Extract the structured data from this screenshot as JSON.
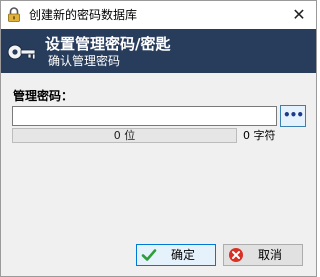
{
  "window": {
    "title": "创建新的密码数据库",
    "close_glyph": "✕"
  },
  "banner": {
    "headline": "设置管理密码/密匙",
    "subline": "确认管理密码"
  },
  "form": {
    "password_label": "管理密码：",
    "password_value": "",
    "reveal_label": "•••",
    "quality_text": "0 位",
    "quality_fraction": 0,
    "char_count_text": "0 字符"
  },
  "buttons": {
    "ok_label": "确定",
    "cancel_label": "取消"
  },
  "icons": {
    "app": "lock-icon",
    "banner": "key-icon",
    "ok": "checkmark-icon",
    "cancel": "cancel-icon"
  },
  "colors": {
    "banner_bg": "#283c5c",
    "accent": "#0078d7",
    "ok_check": "#2e9e3c",
    "cancel_red": "#d93025"
  }
}
